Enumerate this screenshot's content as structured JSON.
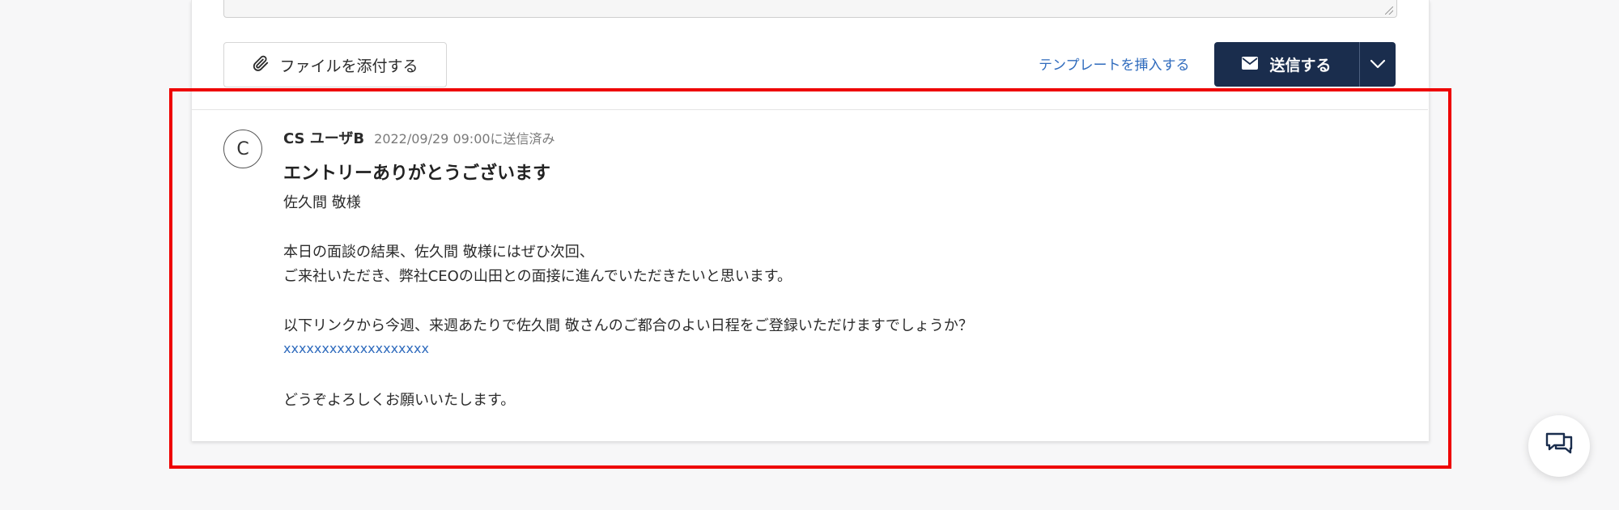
{
  "composer": {
    "attach_label": "ファイルを添付する",
    "template_label": "テンプレートを挿入する",
    "send_label": "送信する"
  },
  "message": {
    "avatar_initial": "C",
    "sender": "CS ユーザB",
    "sent_status": "2022/09/29 09:00に送信済み",
    "subject": "エントリーありがとうございます",
    "body": {
      "greeting": "佐久間 敬様",
      "line1": "本日の面談の結果、佐久間 敬様にはぜひ次回、",
      "line2": "ご来社いただき、弊社CEOの山田との面接に進んでいただきたいと思います。",
      "line3": "以下リンクから今週、来週あたりで佐久間 敬さんのご都合のよい日程をご登録いただけますでしょうか？",
      "link": "xxxxxxxxxxxxxxxxxxx",
      "closing": "どうぞよろしくお願いいたします。"
    }
  },
  "icons": {
    "attach": "paperclip-icon",
    "send": "envelope-icon",
    "dropdown": "chevron-down-icon",
    "chat": "chat-bubbles-icon"
  },
  "colors": {
    "primary": "#1a2d4d",
    "link": "#2f6bbd",
    "highlight": "#ee0000",
    "background": "#f7f7f8"
  }
}
